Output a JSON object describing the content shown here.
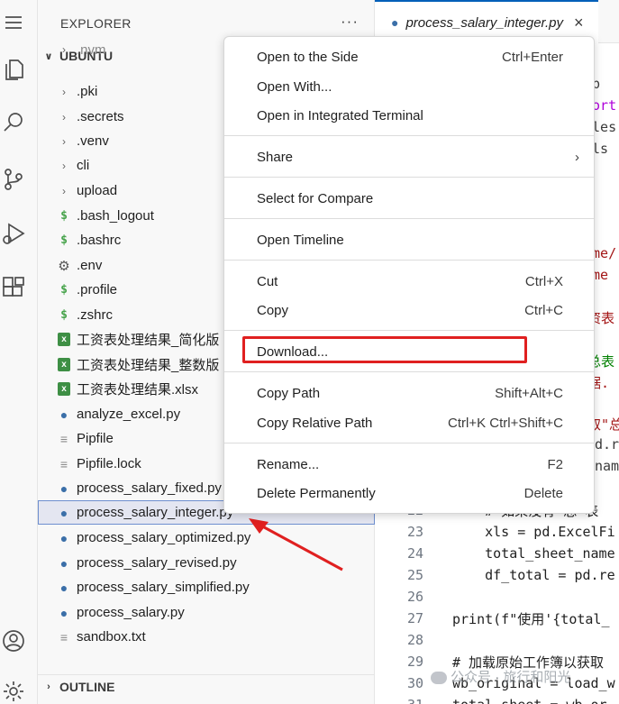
{
  "explorer": {
    "title": "EXPLORER",
    "more": "···",
    "workspace": "UBUNTU",
    "outline": "OUTLINE",
    "items": [
      {
        "label": ".nvm",
        "icon": "chevron-right-icon"
      },
      {
        "label": ".pki",
        "icon": "chevron-right-icon"
      },
      {
        "label": ".secrets",
        "icon": "chevron-right-icon"
      },
      {
        "label": ".venv",
        "icon": "chevron-right-icon"
      },
      {
        "label": "cli",
        "icon": "chevron-right-icon"
      },
      {
        "label": "upload",
        "icon": "chevron-right-icon"
      },
      {
        "label": ".bash_logout",
        "icon": "shell-icon"
      },
      {
        "label": ".bashrc",
        "icon": "shell-icon"
      },
      {
        "label": ".env",
        "icon": "gear-icon"
      },
      {
        "label": ".profile",
        "icon": "shell-icon"
      },
      {
        "label": ".zshrc",
        "icon": "shell-icon"
      },
      {
        "label": "工资表处理结果_简化版",
        "icon": "excel-icon"
      },
      {
        "label": "工资表处理结果_整数版",
        "icon": "excel-icon"
      },
      {
        "label": "工资表处理结果.xlsx",
        "icon": "excel-icon"
      },
      {
        "label": "analyze_excel.py",
        "icon": "python-icon"
      },
      {
        "label": "Pipfile",
        "icon": "file-icon"
      },
      {
        "label": "Pipfile.lock",
        "icon": "file-icon"
      },
      {
        "label": "process_salary_fixed.py",
        "icon": "python-icon"
      },
      {
        "label": "process_salary_integer.py",
        "icon": "python-icon"
      },
      {
        "label": "process_salary_optimized.py",
        "icon": "python-icon"
      },
      {
        "label": "process_salary_revised.py",
        "icon": "python-icon"
      },
      {
        "label": "process_salary_simplified.py",
        "icon": "python-icon"
      },
      {
        "label": "process_salary.py",
        "icon": "python-icon"
      },
      {
        "label": "sandbox.txt",
        "icon": "file-icon"
      }
    ]
  },
  "editor": {
    "tab_label": "process_salary_integer.py",
    "tab_close": "×",
    "fragments": {
      "f1": "mp",
      "f2": "port",
      "f3": "yles",
      "f4": "ils",
      "f5": "ome/",
      "f6": "ome",
      "f7": "资表",
      "f8": "总表",
      "f9": "据.",
      "f10": "取\"总",
      "f11": "d.re",
      "f12": "name"
    },
    "lines": [
      {
        "num": "22",
        "text": "    # 如果没有\"总\"表"
      },
      {
        "num": "23",
        "text": "    xls = pd.ExcelFi"
      },
      {
        "num": "24",
        "text": "    total_sheet_name"
      },
      {
        "num": "25",
        "text": "    df_total = pd.re"
      },
      {
        "num": "26",
        "text": ""
      },
      {
        "num": "27",
        "text": "print(f\"使用'{total_"
      },
      {
        "num": "28",
        "text": ""
      },
      {
        "num": "29",
        "text": "# 加载原始工作簿以获取"
      },
      {
        "num": "30",
        "text": "wb_original = load_w"
      },
      {
        "num": "31",
        "text": "total_sheet = wb_or"
      }
    ]
  },
  "context_menu": {
    "items": [
      {
        "label": "Open to the Side",
        "shortcut": "Ctrl+Enter"
      },
      {
        "label": "Open With...",
        "shortcut": ""
      },
      {
        "label": "Open in Integrated Terminal",
        "shortcut": ""
      },
      {
        "label": "Share",
        "shortcut": "",
        "submenu": "›"
      },
      {
        "label": "Select for Compare",
        "shortcut": ""
      },
      {
        "label": "Open Timeline",
        "shortcut": ""
      },
      {
        "label": "Cut",
        "shortcut": "Ctrl+X"
      },
      {
        "label": "Copy",
        "shortcut": "Ctrl+C"
      },
      {
        "label": "Download...",
        "shortcut": ""
      },
      {
        "label": "Copy Path",
        "shortcut": "Shift+Alt+C"
      },
      {
        "label": "Copy Relative Path",
        "shortcut": "Ctrl+K Ctrl+Shift+C"
      },
      {
        "label": "Rename...",
        "shortcut": "F2"
      },
      {
        "label": "Delete Permanently",
        "shortcut": "Delete"
      }
    ]
  },
  "watermark": "公众号 · 旅行和阳光",
  "colors": {
    "accent": "#005fb8",
    "annotation": "#e02020",
    "selection": "#e4e6f1"
  }
}
